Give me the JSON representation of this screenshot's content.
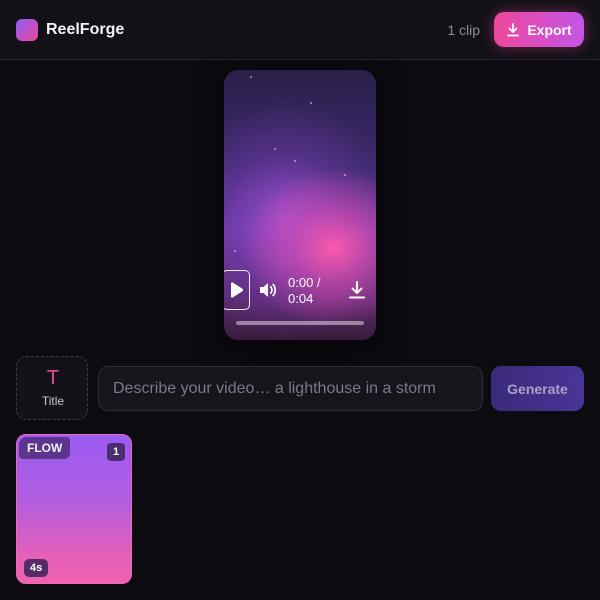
{
  "header": {
    "app_title": "ReelForge",
    "clip_count": "1 clip",
    "export_label": "Export",
    "accent": "#ec4899",
    "brand_gradient": [
      "#8b5cf6",
      "#ec4899"
    ]
  },
  "preview": {
    "time_display": "0:00 / 0:04",
    "progress": 0,
    "icons": [
      "play-icon",
      "volume-icon",
      "download-icon"
    ]
  },
  "prompt": {
    "title_glyph": "T",
    "title_label": "Title",
    "placeholder": "Describe your video… a lighthouse in a storm",
    "value": "",
    "generate_label": "Generate"
  },
  "clips": [
    {
      "badge": "FLOW",
      "index": "1",
      "duration": "4s"
    }
  ]
}
